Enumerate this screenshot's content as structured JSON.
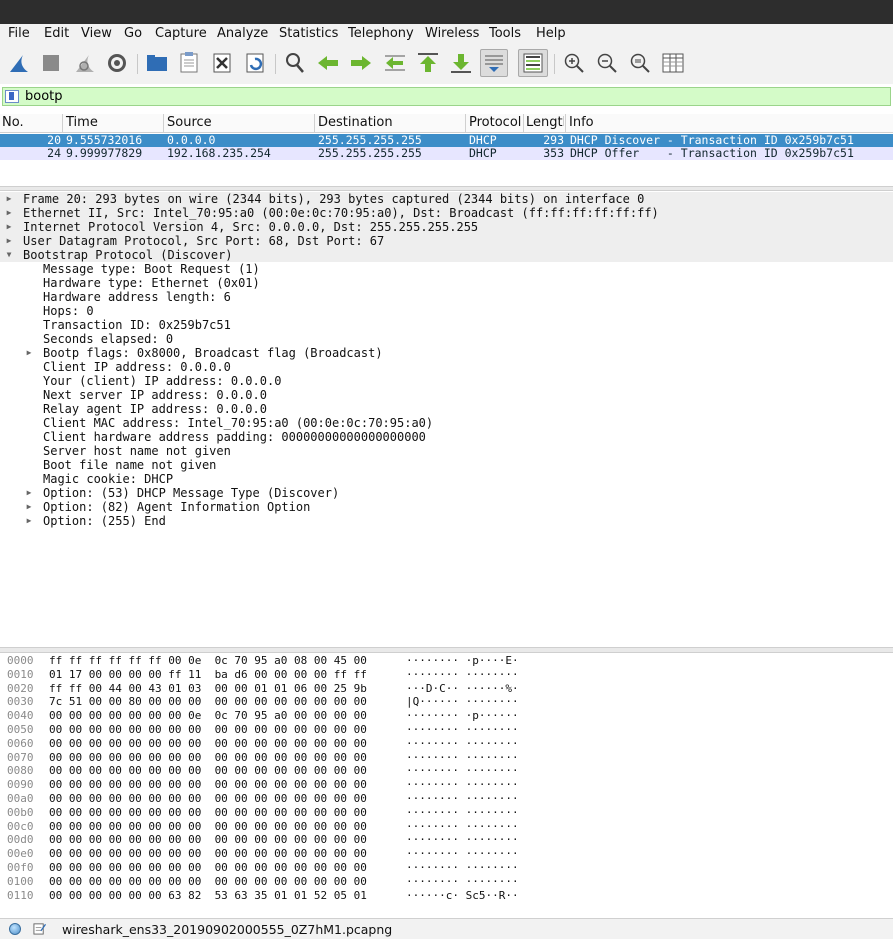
{
  "menu": [
    "File",
    "Edit",
    "View",
    "Go",
    "Capture",
    "Analyze",
    "Statistics",
    "Telephony",
    "Wireless",
    "Tools",
    "Help"
  ],
  "toolbar_icons": [
    "shark-fin-start-icon",
    "stop-capture-icon",
    "restart-capture-icon",
    "capture-options-icon",
    "open-folder-icon",
    "save-file-icon",
    "close-file-icon",
    "reload-file-icon",
    "find-packet-icon",
    "go-back-icon",
    "go-forward-icon",
    "go-to-packet-icon",
    "first-packet-icon",
    "last-packet-icon",
    "autoscroll-icon",
    "colorize-icon",
    "zoom-in-icon",
    "zoom-out-icon",
    "zoom-normal-icon",
    "resize-columns-icon"
  ],
  "filter": {
    "value": "bootp"
  },
  "packet_list": {
    "headers": [
      "No.",
      "Time",
      "Source",
      "Destination",
      "Protocol",
      "Length",
      "Info"
    ],
    "rows": [
      {
        "no": "20",
        "time": "9.555732016",
        "source": "0.0.0.0",
        "destination": "255.255.255.255",
        "protocol": "DHCP",
        "length": "293",
        "info": "DHCP Discover - Transaction ID 0x259b7c51"
      },
      {
        "no": "24",
        "time": "9.999977829",
        "source": "192.168.235.254",
        "destination": "255.255.255.255",
        "protocol": "DHCP",
        "length": "353",
        "info": "DHCP Offer    - Transaction ID 0x259b7c51"
      }
    ]
  },
  "details": [
    {
      "indent": 0,
      "arrow": "right",
      "text": "Frame 20: 293 bytes on wire (2344 bits), 293 bytes captured (2344 bits) on interface 0"
    },
    {
      "indent": 0,
      "arrow": "right",
      "text": "Ethernet II, Src: Intel_70:95:a0 (00:0e:0c:70:95:a0), Dst: Broadcast (ff:ff:ff:ff:ff:ff)"
    },
    {
      "indent": 0,
      "arrow": "right",
      "text": "Internet Protocol Version 4, Src: 0.0.0.0, Dst: 255.255.255.255"
    },
    {
      "indent": 0,
      "arrow": "right",
      "text": "User Datagram Protocol, Src Port: 68, Dst Port: 67"
    },
    {
      "indent": 0,
      "arrow": "down",
      "text": "Bootstrap Protocol (Discover)"
    },
    {
      "indent": 1,
      "arrow": "",
      "text": "Message type: Boot Request (1)"
    },
    {
      "indent": 1,
      "arrow": "",
      "text": "Hardware type: Ethernet (0x01)"
    },
    {
      "indent": 1,
      "arrow": "",
      "text": "Hardware address length: 6"
    },
    {
      "indent": 1,
      "arrow": "",
      "text": "Hops: 0"
    },
    {
      "indent": 1,
      "arrow": "",
      "text": "Transaction ID: 0x259b7c51"
    },
    {
      "indent": 1,
      "arrow": "",
      "text": "Seconds elapsed: 0"
    },
    {
      "indent": 1,
      "arrow": "right",
      "text": "Bootp flags: 0x8000, Broadcast flag (Broadcast)"
    },
    {
      "indent": 1,
      "arrow": "",
      "text": "Client IP address: 0.0.0.0"
    },
    {
      "indent": 1,
      "arrow": "",
      "text": "Your (client) IP address: 0.0.0.0"
    },
    {
      "indent": 1,
      "arrow": "",
      "text": "Next server IP address: 0.0.0.0"
    },
    {
      "indent": 1,
      "arrow": "",
      "text": "Relay agent IP address: 0.0.0.0"
    },
    {
      "indent": 1,
      "arrow": "",
      "text": "Client MAC address: Intel_70:95:a0 (00:0e:0c:70:95:a0)"
    },
    {
      "indent": 1,
      "arrow": "",
      "text": "Client hardware address padding: 00000000000000000000"
    },
    {
      "indent": 1,
      "arrow": "",
      "text": "Server host name not given"
    },
    {
      "indent": 1,
      "arrow": "",
      "text": "Boot file name not given"
    },
    {
      "indent": 1,
      "arrow": "",
      "text": "Magic cookie: DHCP"
    },
    {
      "indent": 1,
      "arrow": "right",
      "text": "Option: (53) DHCP Message Type (Discover)"
    },
    {
      "indent": 1,
      "arrow": "right",
      "text": "Option: (82) Agent Information Option"
    },
    {
      "indent": 1,
      "arrow": "right",
      "text": "Option: (255) End"
    }
  ],
  "hex": [
    {
      "off": "0000",
      "bytes": "ff ff ff ff ff ff 00 0e  0c 70 95 a0 08 00 45 00",
      "ascii": "········ ·p····E·"
    },
    {
      "off": "0010",
      "bytes": "01 17 00 00 00 00 ff 11  ba d6 00 00 00 00 ff ff",
      "ascii": "········ ········"
    },
    {
      "off": "0020",
      "bytes": "ff ff 00 44 00 43 01 03  00 00 01 01 06 00 25 9b",
      "ascii": "···D·C·· ······%·"
    },
    {
      "off": "0030",
      "bytes": "7c 51 00 00 80 00 00 00  00 00 00 00 00 00 00 00",
      "ascii": "|Q······ ········"
    },
    {
      "off": "0040",
      "bytes": "00 00 00 00 00 00 00 0e  0c 70 95 a0 00 00 00 00",
      "ascii": "········ ·p······"
    },
    {
      "off": "0050",
      "bytes": "00 00 00 00 00 00 00 00  00 00 00 00 00 00 00 00",
      "ascii": "········ ········"
    },
    {
      "off": "0060",
      "bytes": "00 00 00 00 00 00 00 00  00 00 00 00 00 00 00 00",
      "ascii": "········ ········"
    },
    {
      "off": "0070",
      "bytes": "00 00 00 00 00 00 00 00  00 00 00 00 00 00 00 00",
      "ascii": "········ ········"
    },
    {
      "off": "0080",
      "bytes": "00 00 00 00 00 00 00 00  00 00 00 00 00 00 00 00",
      "ascii": "········ ········"
    },
    {
      "off": "0090",
      "bytes": "00 00 00 00 00 00 00 00  00 00 00 00 00 00 00 00",
      "ascii": "········ ········"
    },
    {
      "off": "00a0",
      "bytes": "00 00 00 00 00 00 00 00  00 00 00 00 00 00 00 00",
      "ascii": "········ ········"
    },
    {
      "off": "00b0",
      "bytes": "00 00 00 00 00 00 00 00  00 00 00 00 00 00 00 00",
      "ascii": "········ ········"
    },
    {
      "off": "00c0",
      "bytes": "00 00 00 00 00 00 00 00  00 00 00 00 00 00 00 00",
      "ascii": "········ ········"
    },
    {
      "off": "00d0",
      "bytes": "00 00 00 00 00 00 00 00  00 00 00 00 00 00 00 00",
      "ascii": "········ ········"
    },
    {
      "off": "00e0",
      "bytes": "00 00 00 00 00 00 00 00  00 00 00 00 00 00 00 00",
      "ascii": "········ ········"
    },
    {
      "off": "00f0",
      "bytes": "00 00 00 00 00 00 00 00  00 00 00 00 00 00 00 00",
      "ascii": "········ ········"
    },
    {
      "off": "0100",
      "bytes": "00 00 00 00 00 00 00 00  00 00 00 00 00 00 00 00",
      "ascii": "········ ········"
    },
    {
      "off": "0110",
      "bytes": "00 00 00 00 00 00 63 82  53 63 35 01 01 52 05 01",
      "ascii": "······c· Sc5··R··"
    }
  ],
  "status": {
    "filename": "wireshark_ens33_20190902000555_0Z7hM1.pcapng"
  }
}
